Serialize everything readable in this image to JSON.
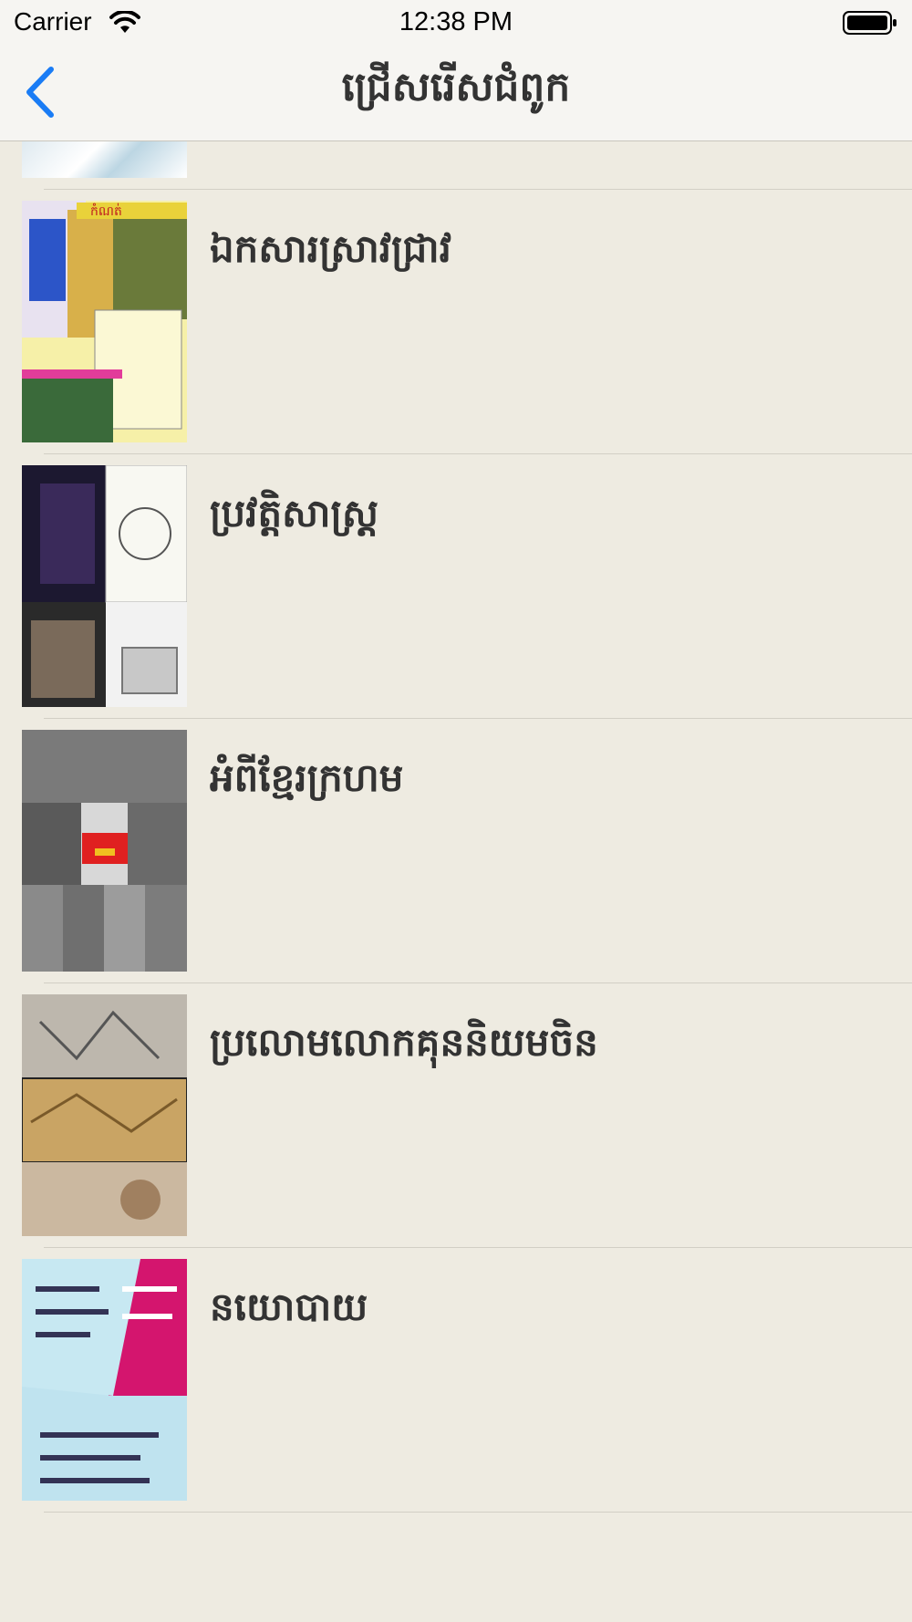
{
  "status_bar": {
    "carrier": "Carrier",
    "time": "12:38 PM",
    "wifi_icon": "wifi-icon",
    "battery_icon": "battery-full-icon"
  },
  "nav": {
    "title": "ជ្រើសរើសជំពូក",
    "back_icon": "chevron-left-icon",
    "accent_color": "#1a7cf5"
  },
  "categories": [
    {
      "label": "ឯកសារស្រាវជ្រាវ"
    },
    {
      "label": "ប្រវត្តិសាស្ត្រ"
    },
    {
      "label": "អំពីខ្មែរក្រហម"
    },
    {
      "label": "ប្រលោមលោកគុននិយមចិន"
    },
    {
      "label": "នយោបាយ"
    }
  ]
}
